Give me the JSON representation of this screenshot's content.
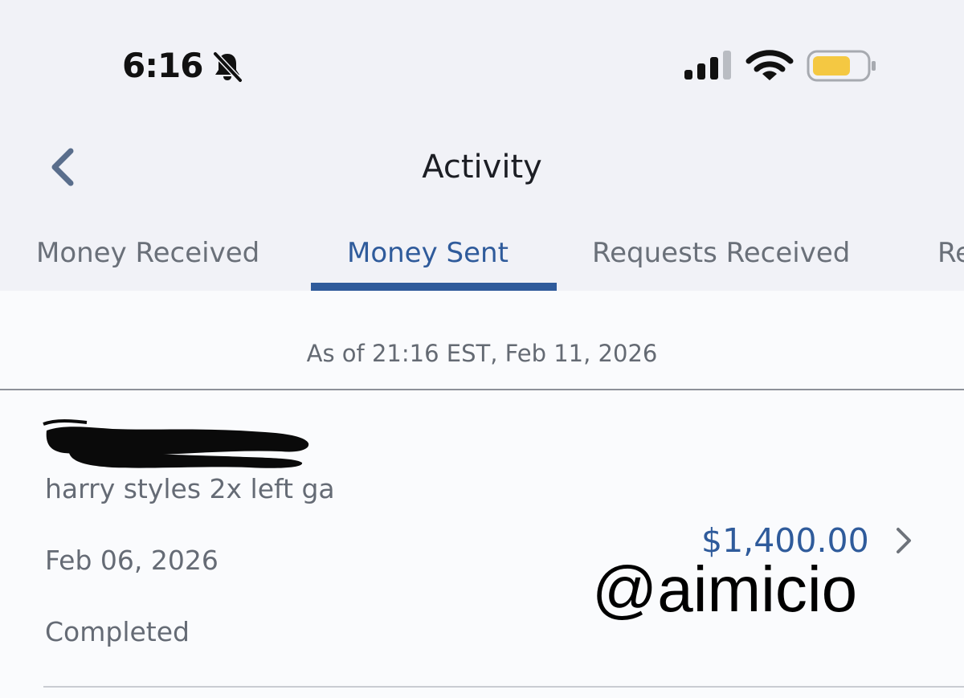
{
  "status_bar": {
    "time": "6:16",
    "icons": [
      "bell-muted-icon",
      "cellular-signal-icon",
      "wifi-icon",
      "battery-icon"
    ],
    "battery_color": "#f4c842"
  },
  "header": {
    "title": "Activity",
    "back_icon": "chevron-left-icon"
  },
  "tabs": [
    {
      "label": "Money Received",
      "active": false
    },
    {
      "label": "Money Sent",
      "active": true
    },
    {
      "label": "Requests Received",
      "active": false
    },
    {
      "label": "Re",
      "active": false
    }
  ],
  "as_of": "As of 21:16 EST, Feb 11, 2026",
  "transaction": {
    "memo": "harry styles 2x left ga",
    "date": "Feb 06, 2026",
    "status": "Completed",
    "amount": "$1,400.00",
    "chevron_icon": "chevron-right-icon"
  },
  "watermark": "@aimicio",
  "colors": {
    "accent": "#2f5b9b",
    "top_background": "#f1f2f7",
    "content_background": "#fafbfd",
    "secondary_text": "#656b75"
  }
}
